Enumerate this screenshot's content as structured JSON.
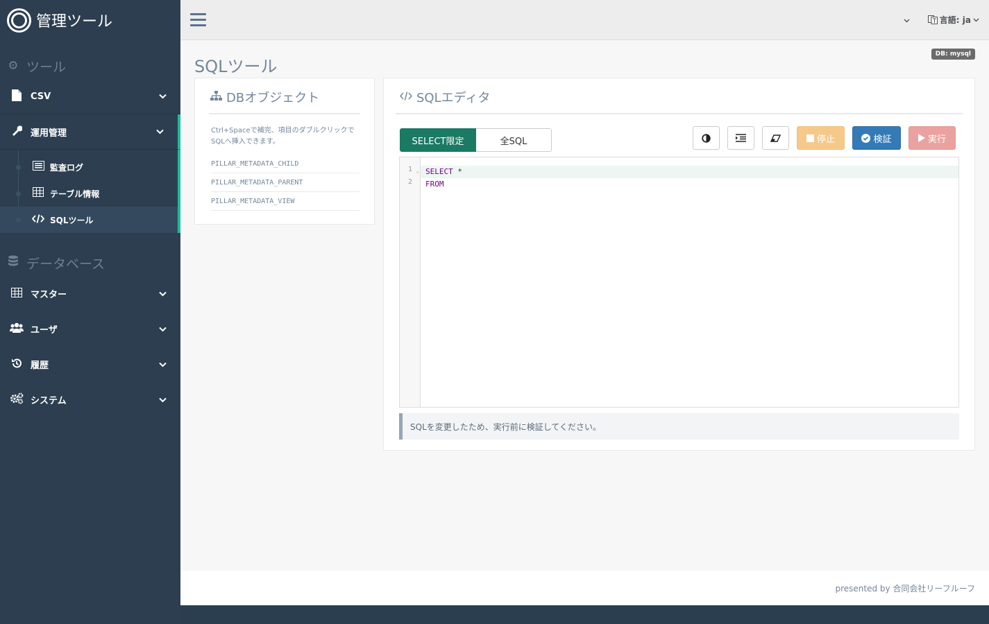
{
  "sidebar": {
    "brand_title": "管理ツール",
    "sections": [
      {
        "label": "ツール"
      },
      {
        "label": "データベース"
      }
    ],
    "tool_items": {
      "csv": "CSV",
      "ops": "運用管理",
      "audit_log": "監査ログ",
      "table_info": "テーブル情報",
      "sql_tool": "SQLツール"
    },
    "db_items": {
      "master": "マスター",
      "user": "ユーザ",
      "history": "履歴",
      "system": "システム"
    },
    "accent_color": "#1abc9c"
  },
  "topbar": {
    "language_label": "言語: ja"
  },
  "page": {
    "title": "SQLツール",
    "db_badge": "DB: mysql"
  },
  "objects_panel": {
    "title": "DBオブジェクト",
    "hint": "Ctrl+Spaceで補完、項目のダブルクリックでSQLへ挿入できます。",
    "items": [
      "PILLAR_METADATA_CHILD",
      "PILLAR_METADATA_PARENT",
      "PILLAR_METADATA_VIEW"
    ]
  },
  "editor_panel": {
    "title": "SQLエディタ",
    "mode_select_only": "SELECT限定",
    "mode_all_sql": "全SQL",
    "stop_label": "停止",
    "verify_label": "検証",
    "run_label": "実行",
    "line_numbers": [
      "1",
      "2"
    ],
    "code_lines": [
      {
        "keyword": "SELECT",
        "rest": " *"
      },
      {
        "keyword": "FROM",
        "rest": ""
      }
    ],
    "notice": "SQLを変更したため、実行前に検証してください。"
  },
  "footer": {
    "text": "presented by 合同会社リーフルーフ"
  }
}
